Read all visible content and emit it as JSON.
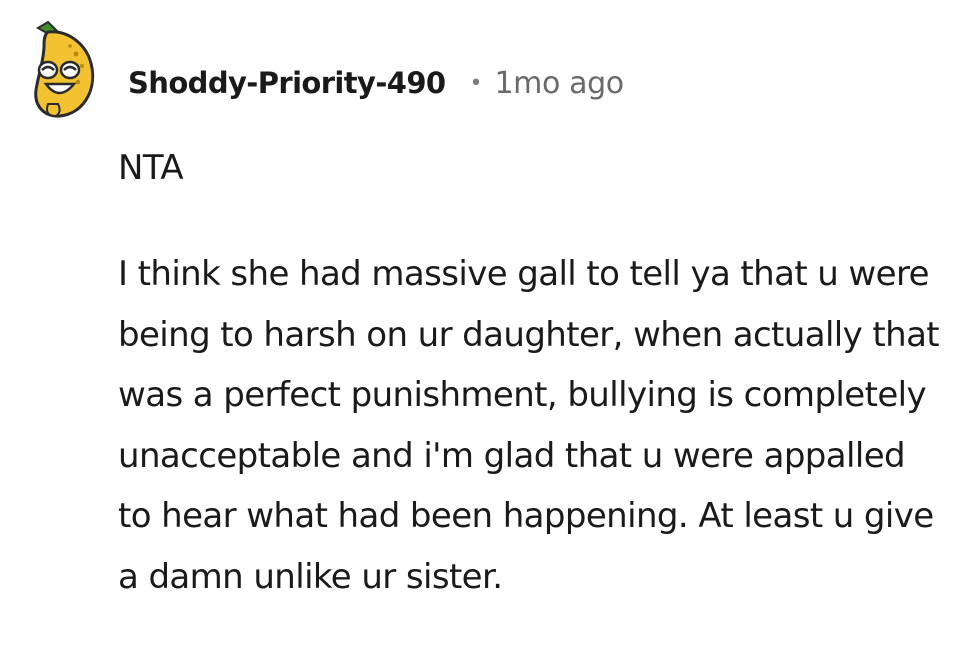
{
  "comment": {
    "author": "Shoddy-Priority-490",
    "separator": "•",
    "timestamp": "1mo ago",
    "avatar_icon": "banana-avatar-icon",
    "verdict": "NTA",
    "paragraph": "I think she had massive gall to tell ya that u were being to harsh on ur daughter, when actually that was a perfect punishment, bullying is completely unacceptable and i'm glad that u were appalled to hear what had been happening. At least u give a damn unlike ur sister."
  },
  "colors": {
    "text": "#1a1a1b",
    "meta": "#6a6a6a",
    "avatar_yellow": "#f2c230",
    "avatar_outline": "#2b2b2b"
  }
}
